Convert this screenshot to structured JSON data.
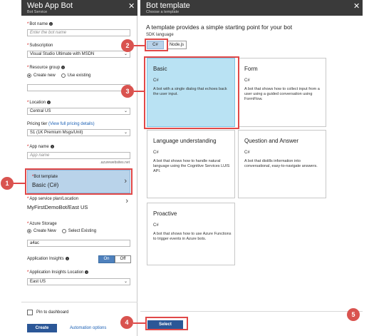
{
  "left_blade": {
    "title": "Web App Bot",
    "subtitle": "Bot Service",
    "close_glyph": "✕",
    "bot_name": {
      "label": "Bot name",
      "placeholder": "Enter the bot name"
    },
    "subscription": {
      "label": "Subscription",
      "value": "Visual Studio Ultimate with MSDN"
    },
    "resource_group": {
      "label": "Resource group",
      "option_create": "Create new",
      "option_existing": "Use existing",
      "selected": "Create new",
      "value": ""
    },
    "location": {
      "label": "Location",
      "value": "Central US"
    },
    "pricing_tier": {
      "label": "Pricing tier",
      "link": "(View full pricing details)",
      "value": "S1 (1K Premium Msgs/Unit)"
    },
    "app_name": {
      "label": "App name",
      "placeholder": "App name",
      "suffix": ".azurewebsites.net"
    },
    "bot_template": {
      "label": "Bot template",
      "value": "Basic (C#)"
    },
    "app_service_plan": {
      "label": "App service plan/Location",
      "value": "MyFirstDemoBot/East US"
    },
    "azure_storage": {
      "label": "Azure Storage",
      "option_create": "Create New",
      "option_existing": "Select Existing",
      "selected": "Create New",
      "value": "a4ac"
    },
    "app_insights": {
      "label": "Application Insights",
      "on": "On",
      "off": "Off",
      "selected": "On"
    },
    "app_insights_location": {
      "label": "Application Insights Location",
      "value": "East US"
    },
    "footer": {
      "pin_label": "Pin to dashboard",
      "pinned": false,
      "create_label": "Create",
      "automation_label": "Automation options"
    }
  },
  "right_blade": {
    "title": "Bot template",
    "subtitle": "Choose a template",
    "close_glyph": "✕",
    "intro": "A template provides a simple starting point for your bot",
    "sdk_label": "SDK language",
    "sdk_options": [
      "C#",
      "Node.js"
    ],
    "sdk_selected": "C#",
    "templates": [
      {
        "title": "Basic",
        "lang": "C#",
        "desc": "A bot with a single dialog that echoes back the user input.",
        "selected": true
      },
      {
        "title": "Form",
        "lang": "C#",
        "desc": "A bot that shows how to collect input from a user using a guided conversation using FormFlow.",
        "selected": false
      },
      {
        "title": "Language understanding",
        "lang": "C#",
        "desc": "A bot that shows how to handle natural language using the Cognitive Services LUIS API.",
        "selected": false
      },
      {
        "title": "Question and Answer",
        "lang": "C#",
        "desc": "A bot that distills information into conversational, easy-to-navigate answers.",
        "selected": false
      },
      {
        "title": "Proactive",
        "lang": "C#",
        "desc": "A bot that shows how to use Azure Functions to trigger events in Azure bots.",
        "selected": false
      }
    ],
    "select_label": "Select"
  },
  "callouts": [
    "1",
    "2",
    "3",
    "4",
    "5"
  ],
  "colors": {
    "header": "#3a3a3a",
    "selected_card": "#b9e2f3",
    "selected_field": "#b9d3ea",
    "primary_button": "#2b5797",
    "callout": "#d9534f",
    "highlight": "#e04848"
  }
}
